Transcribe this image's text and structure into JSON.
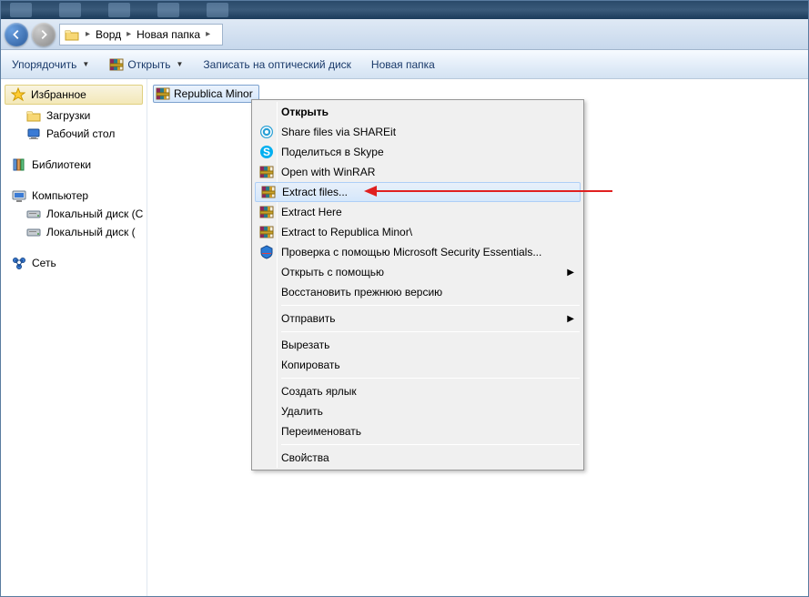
{
  "breadcrumb": {
    "items": [
      "Ворд",
      "Новая папка"
    ]
  },
  "toolbar": {
    "organize": "Упорядочить",
    "open": "Открыть",
    "burn": "Записать на оптический диск",
    "new_folder": "Новая папка"
  },
  "sidebar": {
    "favorites": {
      "label": "Избранное",
      "items": [
        "Загрузки",
        "Рабочий стол"
      ]
    },
    "libraries": {
      "label": "Библиотеки"
    },
    "computer": {
      "label": "Компьютер",
      "items": [
        "Локальный диск (C",
        "Локальный диск ("
      ]
    },
    "network": {
      "label": "Сеть"
    }
  },
  "files": {
    "selected": "Republica Minor"
  },
  "context_menu": {
    "open": "Открыть",
    "shareit": "Share files via SHAREit",
    "skype": "Поделиться в Skype",
    "open_winrar": "Open with WinRAR",
    "extract_files": "Extract files...",
    "extract_here": "Extract Here",
    "extract_to": "Extract to Republica Minor\\",
    "mse": "Проверка с помощью Microsoft Security Essentials...",
    "open_with": "Открыть с помощью",
    "restore_prev": "Восстановить прежнюю версию",
    "send_to": "Отправить",
    "cut": "Вырезать",
    "copy": "Копировать",
    "create_shortcut": "Создать ярлык",
    "delete": "Удалить",
    "rename": "Переименовать",
    "properties": "Свойства"
  }
}
